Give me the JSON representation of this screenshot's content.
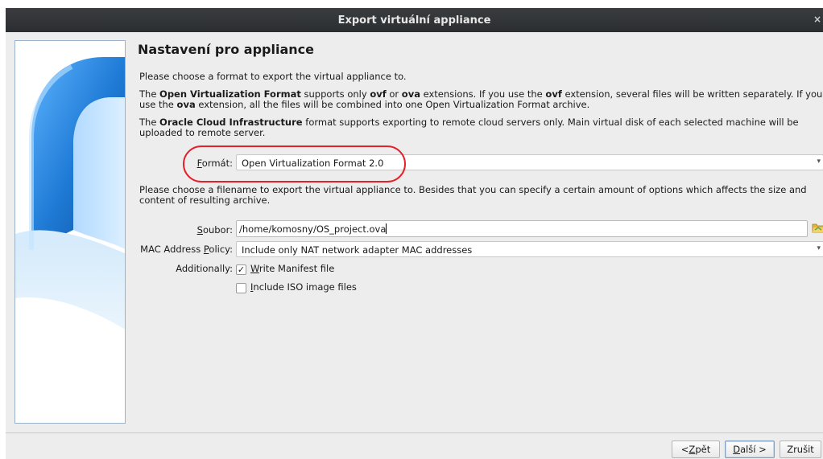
{
  "window": {
    "title": "Export virtuální appliance",
    "close_glyph": "×"
  },
  "page": {
    "title": "Nastavení pro appliance"
  },
  "intro": {
    "line1": "Please choose a format to export the virtual appliance to.",
    "ovf_p1": "The ",
    "ovf_b1": "Open Virtualization Format",
    "ovf_p2": " supports only ",
    "ovf_b2": "ovf",
    "ovf_p3": " or ",
    "ovf_b3": "ova",
    "ovf_p4": " extensions. If you use the ",
    "ovf_b4": "ovf",
    "ovf_p5": " extension, several files will be written separately. If you use the ",
    "ovf_b5": "ova",
    "ovf_p6": " extension, all the files will be combined into one Open Virtualization Format archive.",
    "oci_p1": "The ",
    "oci_b1": "Oracle Cloud Infrastructure",
    "oci_p2": " format supports exporting to remote cloud servers only. Main virtual disk of each selected machine will be uploaded to remote server."
  },
  "format": {
    "label_u": "F",
    "label_rest": "ormát:",
    "value": "Open Virtualization Format 2.0"
  },
  "filename_hint": "Please choose a filename to export the virtual appliance to. Besides that you can specify a certain amount of options which affects the size and content of resulting archive.",
  "file": {
    "label_u": "S",
    "label_rest": "oubor:",
    "value": "/home/komosny/OS_project.ova"
  },
  "mac_policy": {
    "label_pre": "MAC Address ",
    "label_u": "P",
    "label_rest": "olicy:",
    "value": "Include only NAT network adapter MAC addresses"
  },
  "additionally": {
    "label": "Additionally:",
    "manifest": {
      "checked": true,
      "mark": "✓",
      "label_u": "W",
      "label_rest": "rite Manifest file"
    },
    "iso": {
      "checked": false,
      "label_u": "I",
      "label_rest": "nclude ISO image files"
    }
  },
  "buttons": {
    "back": {
      "pre": "< ",
      "u": "Z",
      "rest": "pět"
    },
    "next": {
      "u": "D",
      "rest": "alší >"
    },
    "cancel": "Zrušit"
  },
  "colors": {
    "annotation": "#e4212b",
    "titlebar": "#2f3235",
    "accent_blue": "#1c6fc1"
  }
}
